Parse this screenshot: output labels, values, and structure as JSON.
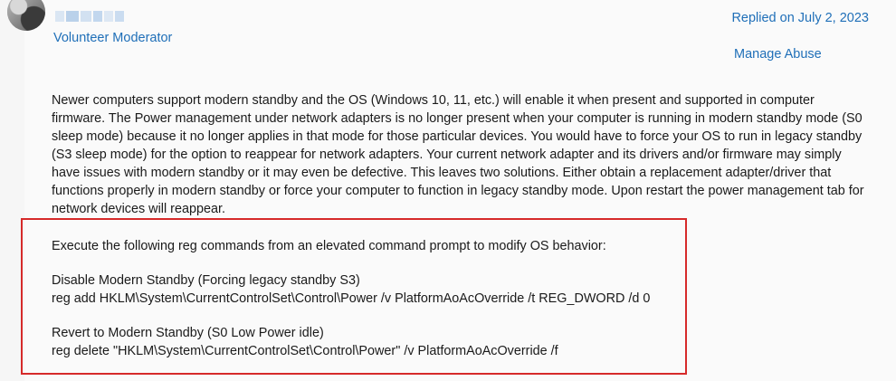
{
  "post": {
    "role": "Volunteer Moderator",
    "replied": "Replied on July 2, 2023",
    "manage_abuse": "Manage Abuse",
    "body": "Newer computers support modern standby and the OS (Windows 10, 11, etc.) will enable it when present and supported in computer firmware. The Power management under network adapters is no longer present when your computer is running in modern standby mode (S0 sleep mode) because it no longer applies in that mode for those particular devices. You would have to force your OS to run in legacy standby (S3 sleep mode) for the option to reappear for network adapters. Your current network adapter and its drivers and/or firmware may simply have issues with modern standby or it may even be defective. This leaves two solutions. Either obtain a replacement adapter/driver that functions properly in modern standby or force your computer to function in legacy standby mode. Upon restart the power management tab for network devices will reappear.",
    "commands": {
      "intro": "Execute the following reg commands from an elevated command prompt to modify OS behavior:",
      "disable_title": "Disable Modern Standby (Forcing legacy standby S3)",
      "disable_cmd": "reg add HKLM\\System\\CurrentControlSet\\Control\\Power /v PlatformAoAcOverride /t REG_DWORD /d 0",
      "revert_title": "Revert to Modern Standby (S0 Low Power idle)",
      "revert_cmd": "reg delete \"HKLM\\System\\CurrentControlSet\\Control\\Power\" /v PlatformAoAcOverride /f"
    }
  },
  "colors": {
    "link": "#1f6fb8",
    "highlight_border": "#d62a2a"
  }
}
